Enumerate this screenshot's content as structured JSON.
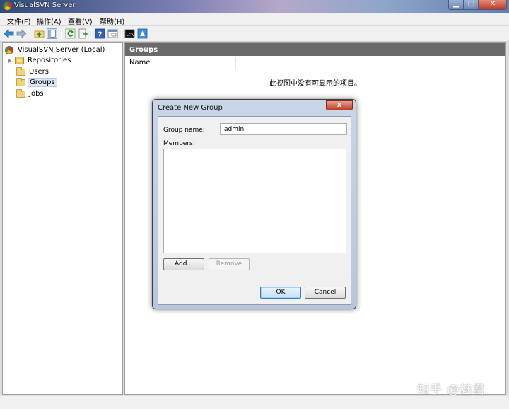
{
  "window": {
    "title": "VisualSVN Server"
  },
  "menu": {
    "items": [
      "文件(F)",
      "操作(A)",
      "查看(V)",
      "帮助(H)"
    ]
  },
  "toolbar": {
    "icons": [
      "back-arrow-icon",
      "forward-arrow-icon",
      "up-folder-icon",
      "show-hide-tree-icon",
      "refresh-icon",
      "export-icon",
      "help-icon",
      "properties-icon",
      "console-icon",
      "azure-icon"
    ]
  },
  "tree": {
    "root": "VisualSVN Server (Local)",
    "items": [
      "Repositories",
      "Users",
      "Groups",
      "Jobs"
    ],
    "selected": "Groups"
  },
  "main": {
    "header": "Groups",
    "column_name": "Name",
    "empty_message": "此视图中没有可显示的项目。"
  },
  "dialog": {
    "title": "Create New Group",
    "close_label": "x",
    "group_name_label": "Group name:",
    "group_name_value": "admin",
    "members_label": "Members:",
    "add_label": "Add...",
    "remove_label": "Remove",
    "ok_label": "OK",
    "cancel_label": "Cancel"
  },
  "watermark": "知乎 @魅君",
  "colors": {
    "header_bg": "#6a6a6a",
    "selection_bg": "#dde6f4",
    "close_red": "#c43a25"
  }
}
